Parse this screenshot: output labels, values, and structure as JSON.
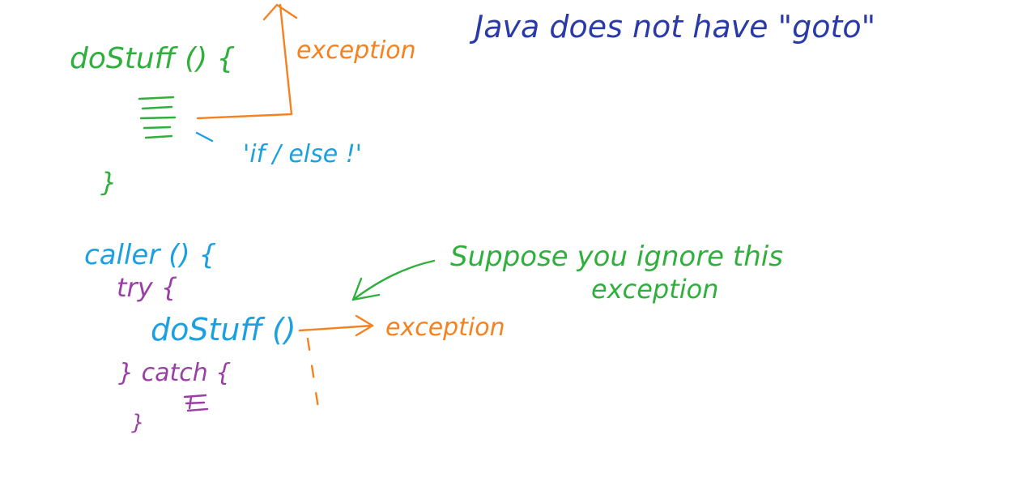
{
  "whiteboard": {
    "colors": {
      "green": "#2fb03c",
      "orange": "#f5821f",
      "blue": "#1ca0e0",
      "navy": "#2a3aa8",
      "purple": "#9a3fa6"
    },
    "note_top_right": "Java does not have \"goto\"",
    "block1": {
      "func_header": "doStuff () {",
      "comment": "'if / else !'",
      "close_brace": "}",
      "exception_label": "exception"
    },
    "block2": {
      "caller_header": "caller () {",
      "try_open": "try {",
      "call_line": "doStuff ()",
      "catch_line": "} catch {",
      "close_brace": "}",
      "exception_label": "exception",
      "annotation_line1": "Suppose you ignore this",
      "annotation_line2": "exception"
    }
  }
}
